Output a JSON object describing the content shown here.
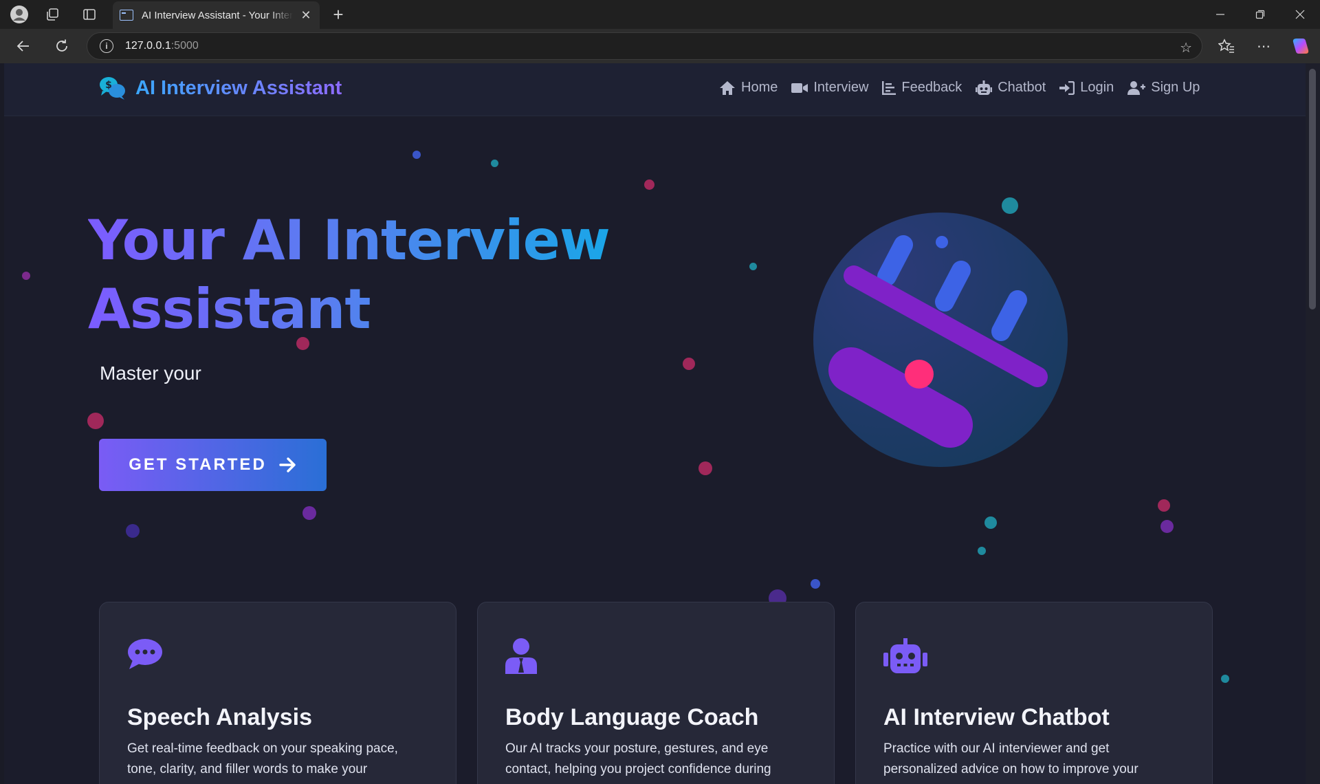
{
  "browser": {
    "tab_title": "AI Interview Assistant - Your Interview Coach",
    "url_host": "127.0.0.1",
    "url_port": ":5000"
  },
  "site": {
    "brand": "AI Interview Assistant",
    "nav": [
      {
        "label": "Home",
        "icon": "home-icon"
      },
      {
        "label": "Interview",
        "icon": "video-camera-icon"
      },
      {
        "label": "Feedback",
        "icon": "chart-bars-icon"
      },
      {
        "label": "Chatbot",
        "icon": "robot-icon"
      },
      {
        "label": "Login",
        "icon": "sign-in-icon"
      },
      {
        "label": "Sign Up",
        "icon": "user-plus-icon"
      }
    ]
  },
  "hero": {
    "title_line1": "Your AI Interview",
    "title_line2": "Assistant",
    "subtitle": "Master your",
    "cta_label": "GET STARTED"
  },
  "features": [
    {
      "icon": "speech-bubble-icon",
      "title": "Speech Analysis",
      "description": "Get real-time feedback on your speaking pace, tone, clarity, and filler words to make your"
    },
    {
      "icon": "user-tie-icon",
      "title": "Body Language Coach",
      "description": "Our AI tracks your posture, gestures, and eye contact, helping you project confidence during"
    },
    {
      "icon": "robot-icon",
      "title": "AI Interview Chatbot",
      "description": "Practice with our AI interviewer and get personalized advice on how to improve your"
    }
  ],
  "colors": {
    "accent_purple": "#7a5cf5",
    "accent_blue": "#2a6fd6",
    "page_bg": "#1b1c2b"
  }
}
